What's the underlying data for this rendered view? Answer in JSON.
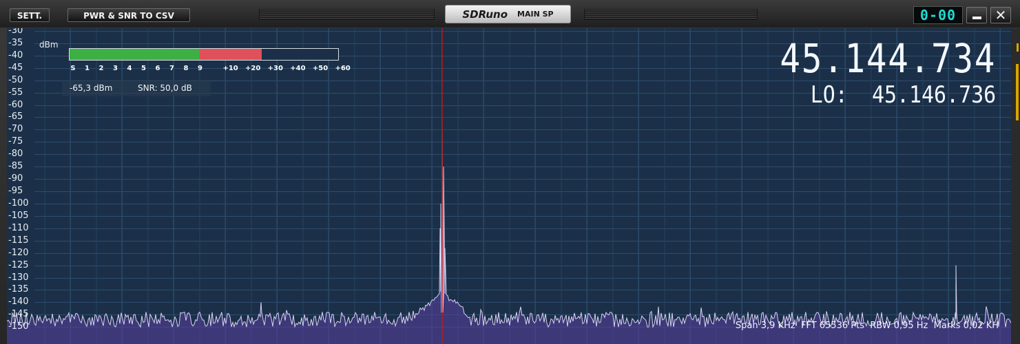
{
  "titlebar": {
    "settings_button": "SETT.",
    "csv_button": "PWR & SNR TO CSV",
    "app_logo": "SDRuno",
    "panel_name": "MAIN SP",
    "clock": "0-00",
    "close_glyph": "✕"
  },
  "colors": {
    "background": "#1b3048",
    "grid": "#2e4d6e",
    "trace": "#d9d4f2",
    "fill": "#5a3fa0",
    "marker": "#c01818",
    "smeter_green": "#3cb043",
    "smeter_red": "#e0505a"
  },
  "spectrum": {
    "unit_label": "dBm",
    "y_ticks": [
      "-30",
      "-35",
      "-40",
      "-45",
      "-50",
      "-55",
      "-60",
      "-65",
      "-70",
      "-75",
      "-80",
      "-85",
      "-90",
      "-95",
      "-100",
      "-105",
      "-110",
      "-115",
      "-120",
      "-125",
      "-130",
      "-135",
      "-140",
      "-145",
      "-150"
    ],
    "y_top_dbm": -30,
    "y_bottom_dbm": -150,
    "noise_floor_dbm": -147,
    "peaks": [
      {
        "label": "main carrier",
        "x_fraction": 0.4334,
        "level_dbm": -65.3
      },
      {
        "label": "right spur",
        "x_fraction": 0.9452,
        "level_dbm": -125
      },
      {
        "label": "left spur",
        "x_fraction": 0.2528,
        "level_dbm": -140
      }
    ],
    "status": {
      "span": "Span 3,9 KHz",
      "fft": "FFT 65536 Pts",
      "rbw": "RBW 0,95 Hz",
      "marks": "Marks 0,02 KH"
    }
  },
  "smeter": {
    "scale": [
      "S",
      "1",
      "2",
      "3",
      "4",
      "5",
      "6",
      "7",
      "8",
      "9",
      "+10",
      "+20",
      "+30",
      "+40",
      "+50",
      "+60"
    ],
    "green_fraction": 0.483,
    "red_fraction": 0.232,
    "power": "-65,3 dBm",
    "snr": "SNR: 50,0 dB"
  },
  "frequency": {
    "main": "45.144.734",
    "lo_label": "LO:",
    "lo_value": "45.146.736"
  }
}
